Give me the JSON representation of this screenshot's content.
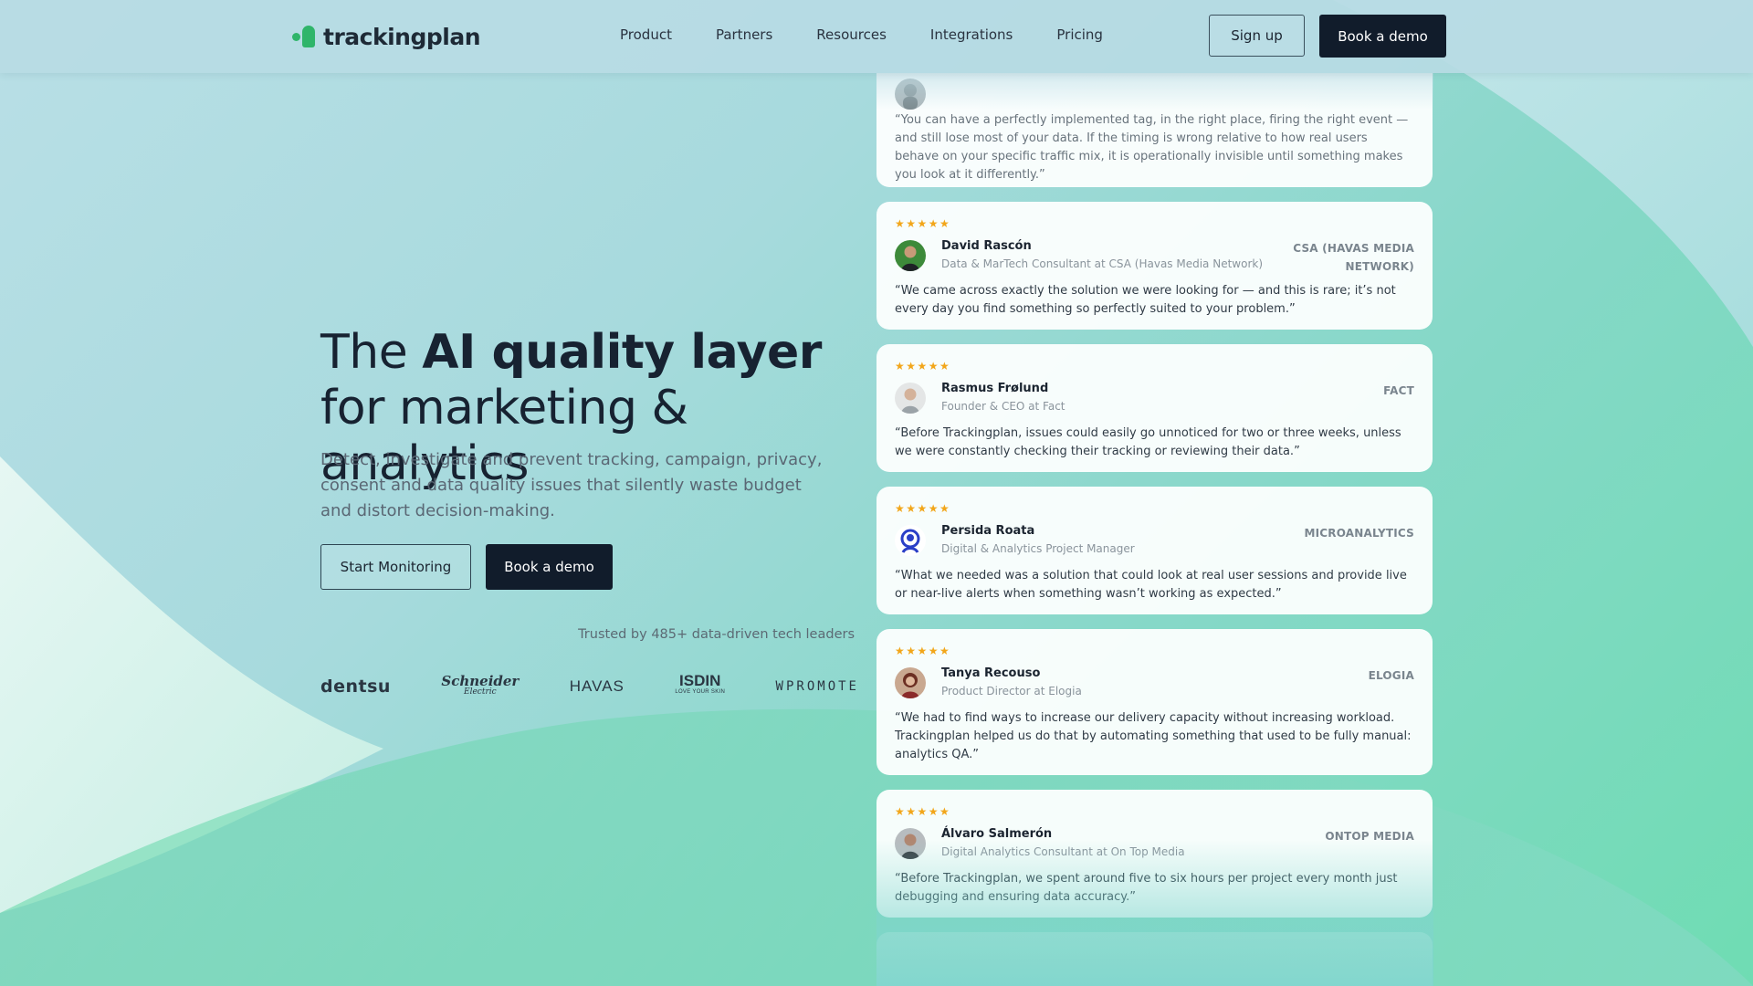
{
  "nav": {
    "logo_text": "trackingplan",
    "menu": [
      {
        "label": "Product"
      },
      {
        "label": "Partners"
      },
      {
        "label": "Resources"
      },
      {
        "label": "Integrations"
      },
      {
        "label": "Pricing"
      }
    ],
    "signup_label": "Sign up",
    "demo_label": "Book a demo"
  },
  "hero": {
    "title_pre": "The ",
    "title_bold": "AI quality layer",
    "title_post": " for marketing & analytics",
    "subtitle": "Detect, investigate and prevent tracking, campaign, privacy, consent and data quality issues that silently waste budget and distort decision-making.",
    "start_label": "Start Monitoring",
    "demo_label": "Book a demo",
    "trusted": "Trusted by 485+ data-driven tech leaders"
  },
  "client_logos": {
    "dentsu": "dentsu",
    "schneider": "Schneider",
    "schneider_sub": "Electric",
    "havas": "HAVAS",
    "isdin": "ISDIN",
    "isdin_sub": "LOVE YOUR SKIN",
    "wpromote": "WPROMOTE"
  },
  "testimonials": [
    {
      "quote": "“You can have a perfectly implemented tag, in the right place, firing the right event — and still lose most of your data. If the timing is wrong relative to how real users behave on your specific traffic mix, it is operationally invisible until something makes you look at it differently.”"
    },
    {
      "stars": "★★★★★",
      "name": "David Rascón",
      "role": "Data & MarTech Consultant at CSA (Havas Media Network)",
      "company": "CSA (HAVAS MEDIA NETWORK)",
      "quote": "“We came across exactly the solution we were looking for — and this is rare; it’s not every day you find something so perfectly suited to your problem.”"
    },
    {
      "stars": "★★★★★",
      "name": "Rasmus Frølund",
      "role": "Founder & CEO at Fact",
      "company": "FACT",
      "quote": "“Before Trackingplan, issues could easily go unnoticed for two or three weeks, unless we were constantly checking their tracking or reviewing their data.”"
    },
    {
      "stars": "★★★★★",
      "name": "Persida Roata",
      "role": "Digital & Analytics Project Manager",
      "company": "MICROANALYTICS",
      "quote": "“What we needed was a solution that could look at real user sessions and provide live or near-live alerts when something wasn’t working as expected.”"
    },
    {
      "stars": "★★★★★",
      "name": "Tanya Recouso",
      "role": "Product Director at Elogia",
      "company": "ELOGIA",
      "quote": "“We had to find ways to increase our delivery capacity without increasing workload. Trackingplan helped us do that by automating something that used to be fully manual: analytics QA.”"
    },
    {
      "stars": "★★★★★",
      "name": "Álvaro Salmerón",
      "role": "Digital Analytics Consultant at On Top Media",
      "company": "ONTOP MEDIA",
      "quote": "“Before Trackingplan, we spent around five to six hours per project every month just debugging and ensuring data accuracy.”"
    }
  ],
  "colors": {
    "accent": "#2fb56a",
    "dark": "#111c2b",
    "star": "#f2a61a"
  }
}
